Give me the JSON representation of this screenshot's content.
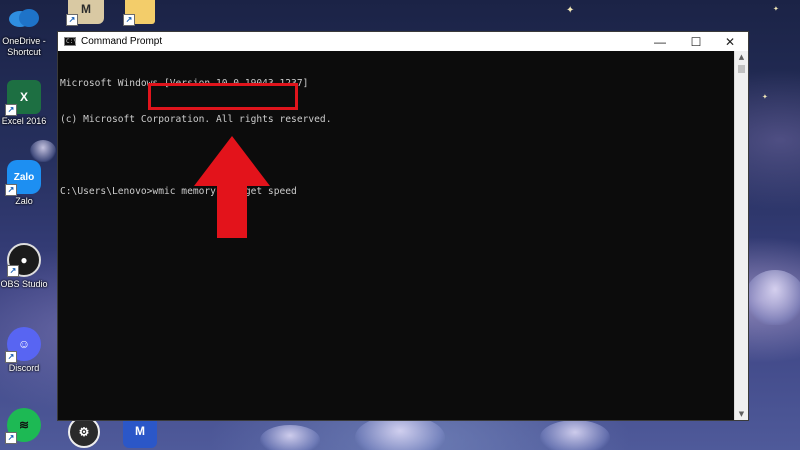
{
  "window": {
    "title": "Command Prompt",
    "icon": "cmd-icon",
    "minimize_glyph": "—",
    "maximize_glyph": "☐",
    "close_glyph": "✕"
  },
  "console": {
    "lines": [
      "Microsoft Windows [Version 10.0.19043.1237]",
      "(c) Microsoft Corporation. All rights reserved.",
      "",
      "C:\\Users\\Lenovo>wmic memorychip get speed"
    ]
  },
  "annotations": {
    "highlight_color": "#e0141c",
    "arrow_color": "#e3131b",
    "arrow_direction": "up"
  },
  "desktop": {
    "icons": [
      {
        "name": "onedrive-shortcut-icon",
        "label": "OneDrive -\nShortcut"
      },
      {
        "name": "excel-icon",
        "label": "Excel 2016"
      },
      {
        "name": "zalo-icon",
        "label": "Zalo",
        "glyph": "Zalo"
      },
      {
        "name": "obs-studio-icon",
        "label": "OBS Studio"
      },
      {
        "name": "discord-icon",
        "label": "Discord"
      },
      {
        "name": "spotify-icon",
        "label": ""
      }
    ],
    "top_icons": [
      {
        "name": "app-tile-icon",
        "glyph": "M"
      },
      {
        "name": "folder-icon",
        "glyph": ""
      }
    ],
    "bottom_icons": [
      {
        "name": "steam-icon",
        "glyph": ""
      },
      {
        "name": "app-tile-bottom-icon",
        "glyph": "M"
      }
    ]
  },
  "colors": {
    "console_bg": "#0c0c0c",
    "console_text": "#cccccc",
    "titlebar_bg": "#ffffff"
  }
}
